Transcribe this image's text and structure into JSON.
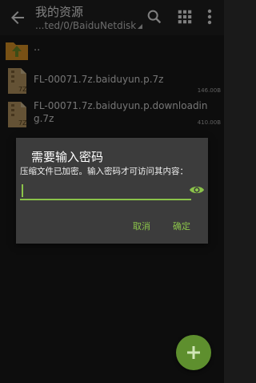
{
  "header": {
    "title": "我的资源",
    "path": "...ted/0/BaiduNetdisk"
  },
  "list": {
    "parent_label": "..",
    "files": [
      {
        "name": "FL-00071.7z.baiduyun.p.7z",
        "size": "146.00B",
        "type_label": "7Z"
      },
      {
        "name": "FL-00071.7z.baiduyun.p.downloading.7z",
        "size": "410.00B",
        "type_label": "7Z"
      }
    ]
  },
  "dialog": {
    "title": "需要输入密码",
    "message": "压缩文件已加密。输入密码才可访问其内容：",
    "password_value": "",
    "cancel_label": "取消",
    "ok_label": "确定"
  },
  "colors": {
    "accent": "#8bc34a",
    "folder": "#f0a32a",
    "fab": "#5e8f2e"
  },
  "icons": {
    "back": "arrow-left-icon",
    "search": "search-icon",
    "grid": "grid-icon",
    "more": "more-vert-icon",
    "eye": "eye-icon",
    "fab": "plus-icon"
  }
}
